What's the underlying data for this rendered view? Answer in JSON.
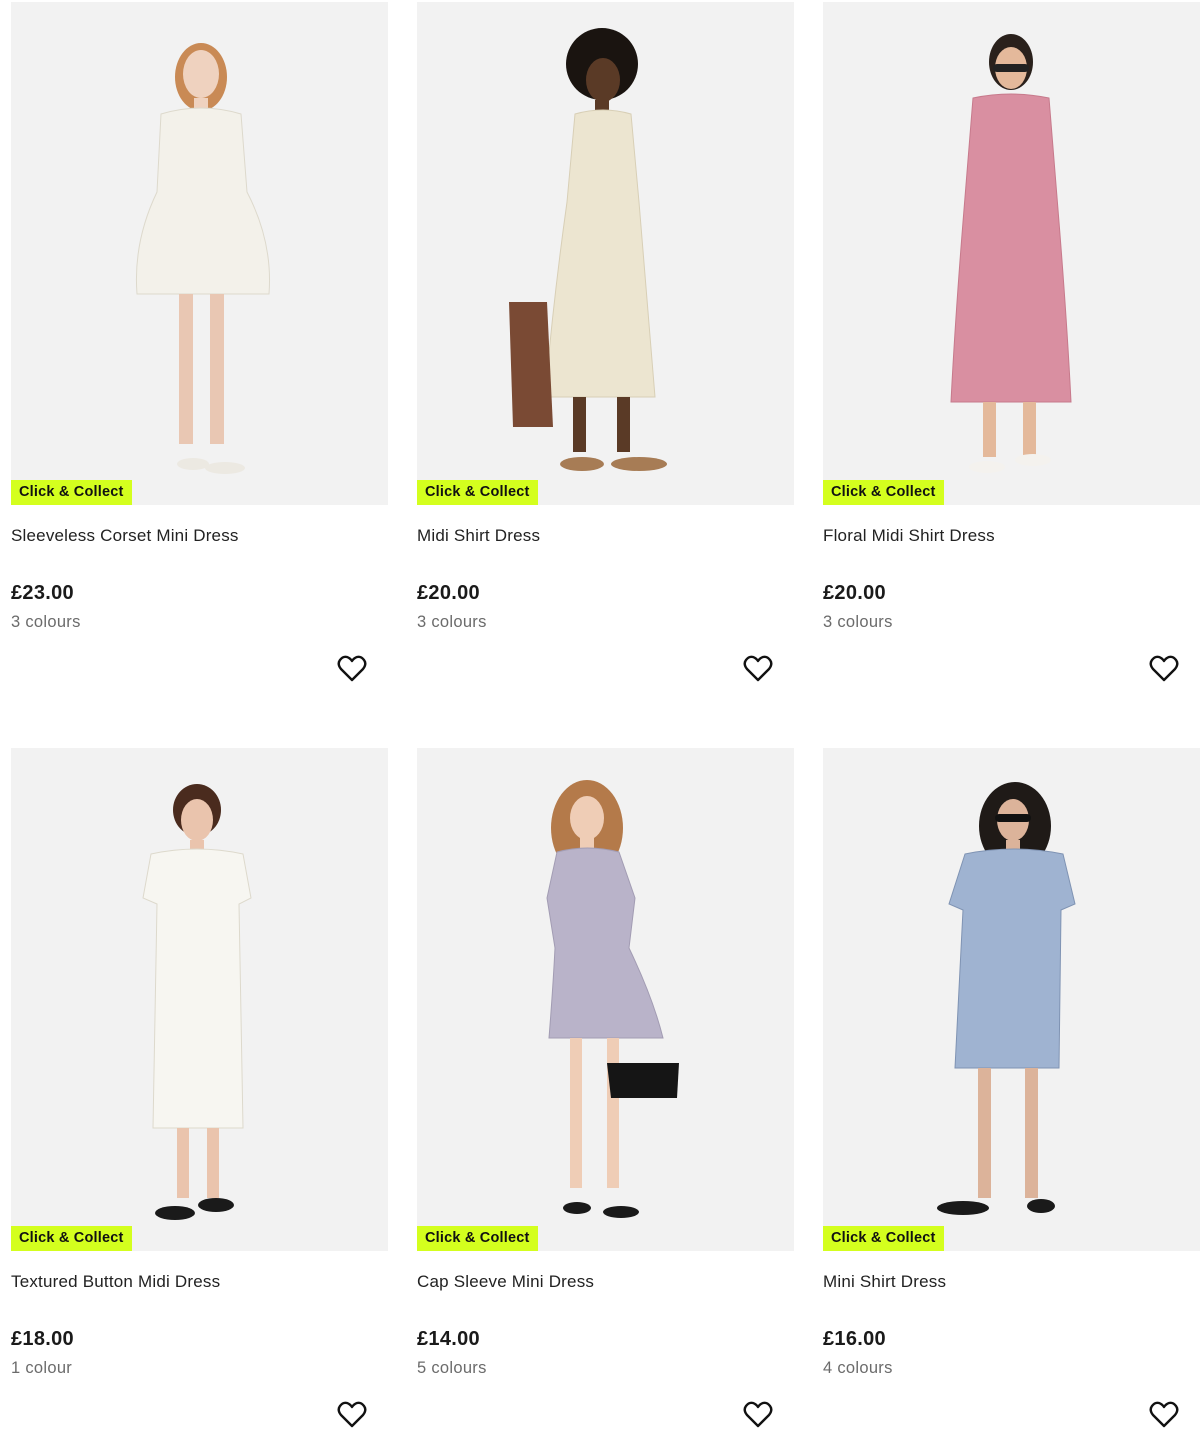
{
  "products": [
    {
      "badge": "Click & Collect",
      "title": "Sleeveless Corset Mini Dress",
      "price": "£23.00",
      "colours": "3 colours",
      "dress_color": "#f3f1ea",
      "hair_color": "#c98a55",
      "icon": "heart-outline-icon"
    },
    {
      "badge": "Click & Collect",
      "title": "Midi Shirt Dress",
      "price": "£20.00",
      "colours": "3 colours",
      "dress_color": "#ece5d0",
      "hair_color": "#1a1410",
      "icon": "heart-outline-icon"
    },
    {
      "badge": "Click & Collect",
      "title": "Floral Midi Shirt Dress",
      "price": "£20.00",
      "colours": "3 colours",
      "dress_color": "#d98fa1",
      "hair_color": "#2a211c",
      "icon": "heart-outline-icon"
    },
    {
      "badge": "Click & Collect",
      "title": "Textured Button Midi Dress",
      "price": "£18.00",
      "colours": "1 colour",
      "dress_color": "#f7f6f1",
      "hair_color": "#4a2b1e",
      "icon": "heart-outline-icon"
    },
    {
      "badge": "Click & Collect",
      "title": "Cap Sleeve Mini Dress",
      "price": "£14.00",
      "colours": "5 colours",
      "dress_color": "#b9b3c9",
      "hair_color": "#b47a4a",
      "icon": "heart-outline-icon"
    },
    {
      "badge": "Click & Collect",
      "title": "Mini Shirt Dress",
      "price": "£16.00",
      "colours": "4 colours",
      "dress_color": "#9fb3d1",
      "hair_color": "#1f1a17",
      "icon": "heart-outline-icon"
    }
  ],
  "theme": {
    "badge_color": "#d4ff1e",
    "image_bg": "#f2f2f2"
  }
}
